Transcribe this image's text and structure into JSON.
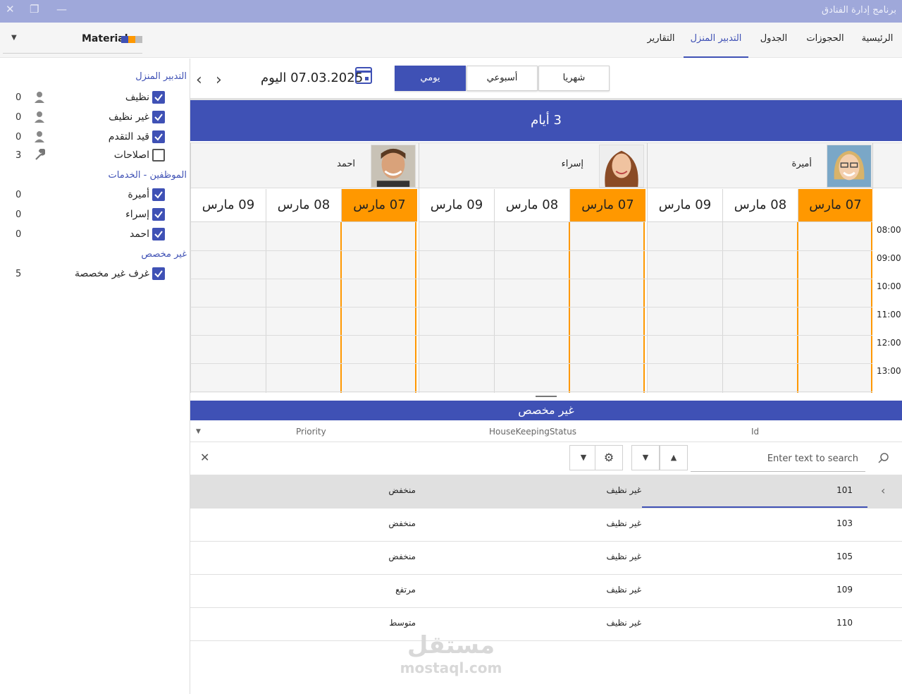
{
  "window": {
    "title": "برنامج إدارة الفنادق"
  },
  "menu": {
    "items": [
      "الرئيسية",
      "الحجوزات",
      "الجدول",
      "التدبير المنزل",
      "التقارير"
    ],
    "active": "التدبير المنزل"
  },
  "theme": {
    "name": "Material",
    "swatch_colors": [
      "#3f51b5",
      "#ff9800",
      "#bdbdbd"
    ]
  },
  "sidebar": {
    "housekeeping_heading": "التدبير المنزل",
    "statuses": [
      {
        "label": "نظيف",
        "count": "0",
        "checked": true,
        "icon": "person-icon"
      },
      {
        "label": "غير نظيف",
        "count": "0",
        "checked": true,
        "icon": "person-icon"
      },
      {
        "label": "قيد التقدم",
        "count": "0",
        "checked": true,
        "icon": "person-icon"
      },
      {
        "label": "اصلاحات",
        "count": "3",
        "checked": false,
        "icon": "wrench-icon"
      }
    ],
    "staff_heading": "الموظفين - الخدمات",
    "staff": [
      {
        "label": "أميرة",
        "count": "0",
        "checked": true
      },
      {
        "label": "إسراء",
        "count": "0",
        "checked": true
      },
      {
        "label": "احمد",
        "count": "0",
        "checked": true
      }
    ],
    "unassigned_heading": "غير مخصص",
    "unassigned": [
      {
        "label": "غرف غير مخصصة",
        "count": "5",
        "checked": true
      }
    ]
  },
  "toolbar": {
    "date_text": "07.03.2025 اليوم",
    "views": [
      "شهريا",
      "أسبوعي",
      "يومي"
    ],
    "active_view": "يومي"
  },
  "scheduler": {
    "header": "3 أيام",
    "resources": [
      {
        "name": "أميرة",
        "days": [
          "07 مارس",
          "08 مارس",
          "09 مارس"
        ]
      },
      {
        "name": "إسراء",
        "days": [
          "07 مارس",
          "08 مارس",
          "09 مارس"
        ]
      },
      {
        "name": "احمد",
        "days": [
          "07 مارس",
          "08 مارس",
          "09 مارس"
        ]
      }
    ],
    "today": "07 مارس",
    "times": [
      "08:00",
      "09:00",
      "10:00",
      "11:00",
      "12:00",
      "13:00"
    ],
    "colors": {
      "header": "#3f51b5",
      "today": "#ff9800"
    }
  },
  "unassigned_grid": {
    "header": "غير مخصص",
    "columns": [
      "Id",
      "HouseKeepingStatus",
      "Priority"
    ],
    "search_placeholder": "Enter text to search",
    "rows": [
      {
        "id": "101",
        "status": "غير نظيف",
        "priority": "منخفض",
        "selected": true
      },
      {
        "id": "103",
        "status": "غير نظيف",
        "priority": "منخفض",
        "selected": false
      },
      {
        "id": "105",
        "status": "غير نظيف",
        "priority": "منخفض",
        "selected": false
      },
      {
        "id": "109",
        "status": "غير نظيف",
        "priority": "مرتفع",
        "selected": false
      },
      {
        "id": "110",
        "status": "غير نظيف",
        "priority": "متوسط",
        "selected": false
      }
    ]
  },
  "watermark": {
    "arabic": "مستقل",
    "latin": "mostaql.com"
  }
}
